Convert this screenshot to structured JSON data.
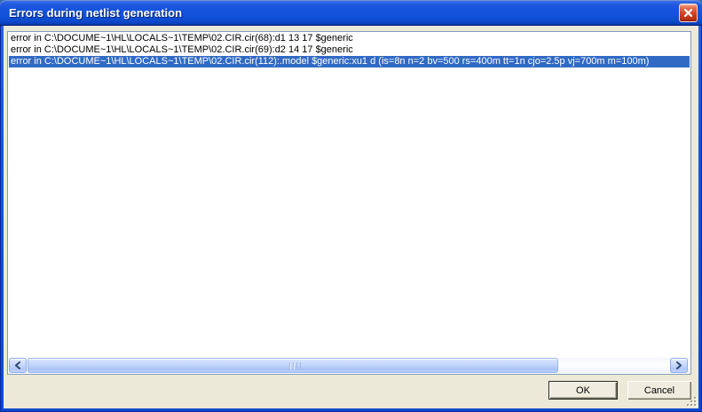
{
  "window": {
    "title": "Errors during netlist generation"
  },
  "errors": [
    {
      "text": "error in C:\\DOCUME~1\\HL\\LOCALS~1\\TEMP\\02.CIR.cir(68):d1 13 17 $generic",
      "selected": false
    },
    {
      "text": "error in C:\\DOCUME~1\\HL\\LOCALS~1\\TEMP\\02.CIR.cir(69):d2 14 17 $generic",
      "selected": false
    },
    {
      "text": "error in C:\\DOCUME~1\\HL\\LOCALS~1\\TEMP\\02.CIR.cir(112):.model $generic:xu1 d (is=8n n=2 bv=500 rs=400m tt=1n cjo=2.5p vj=700m m=100m)",
      "selected": true
    }
  ],
  "buttons": {
    "ok_label": "OK",
    "cancel_label": "Cancel"
  },
  "icons": {
    "close": "close-icon",
    "scroll_left": "chevron-left-icon",
    "scroll_right": "chevron-right-icon"
  },
  "colors": {
    "selection_blue": "#316AC5",
    "titlebar_blue": "#1150D8",
    "client_bg": "#ECE9D8",
    "listbox_border": "#7F9DB9",
    "close_red": "#C93A23"
  }
}
